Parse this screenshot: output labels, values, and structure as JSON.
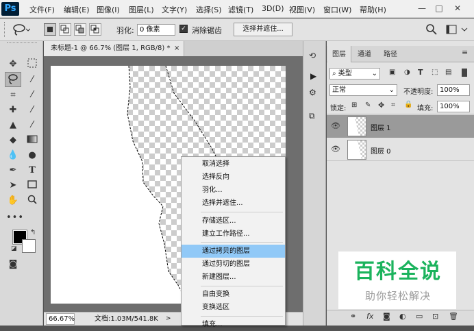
{
  "app": {
    "logo": "Ps"
  },
  "menu": [
    "文件(F)",
    "编辑(E)",
    "图像(I)",
    "图层(L)",
    "文字(Y)",
    "选择(S)",
    "滤镜(T)",
    "3D(D)",
    "视图(V)",
    "窗口(W)",
    "帮助(H)"
  ],
  "window_controls": {
    "minimize": "—",
    "maximize": "□",
    "close": "✕"
  },
  "options": {
    "feather_label": "羽化:",
    "feather_value": "0 像素",
    "antialias_label": "消除锯齿",
    "antialias_checked": true,
    "select_mask_button": "选择并遮住..."
  },
  "document": {
    "tab_title": "未标题-1 @ 66.7% (图层 1, RGB/8) *",
    "tab_close": "×",
    "zoom": "66.67%",
    "doc_info": "文档:1.03M/541.8K"
  },
  "context_menu": {
    "items": [
      {
        "label": "取消选择"
      },
      {
        "label": "选择反向"
      },
      {
        "label": "羽化..."
      },
      {
        "label": "选择并遮住..."
      },
      {
        "label": "存储选区..."
      },
      {
        "label": "建立工作路径..."
      },
      {
        "label": "通过拷贝的图层"
      },
      {
        "label": "通过剪切的图层"
      },
      {
        "label": "新建图层..."
      },
      {
        "label": "自由变换"
      },
      {
        "label": "变换选区"
      },
      {
        "label": "填充..."
      }
    ],
    "highlighted_index": 6
  },
  "layers_panel": {
    "tabs": [
      "图层",
      "通道",
      "路径"
    ],
    "filter_label": "类型",
    "blend_mode": "正常",
    "opacity_label": "不透明度:",
    "opacity_value": "100%",
    "lock_label": "锁定:",
    "fill_label": "填充:",
    "fill_value": "100%",
    "layers": [
      {
        "name": "图层 1",
        "selected": true,
        "visible": true
      },
      {
        "name": "图层 0",
        "selected": false,
        "visible": true
      }
    ]
  },
  "watermark": {
    "title": "百科全说",
    "subtitle": "助你轻松解决"
  },
  "colors": {
    "accent_highlight": "#91c9f7",
    "ps_blue": "#31a8ff",
    "watermark_green": "#1bb35d"
  }
}
